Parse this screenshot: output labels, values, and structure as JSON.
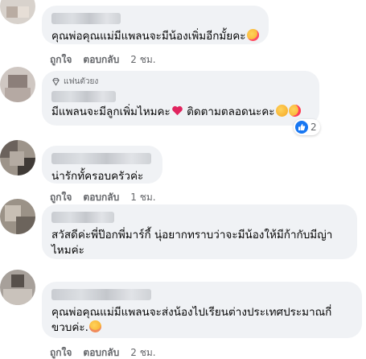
{
  "colors": {
    "bubble": "#f0f2f5",
    "meta": "#65676b",
    "text": "#050505",
    "like": "#1877f2"
  },
  "comments": [
    {
      "text": "คุณพ่อคุณแม่มีแพลนจะมีน้องเพิ่มอีกมั้ยคะ",
      "emoji": "smiling-face-with-hearts",
      "like": "ถูกใจ",
      "reply": "ตอบกลับ",
      "time": "2 ชม."
    },
    {
      "badge": "แฟนตัวยง",
      "text": "มีแพลนจะมีลูกเพิ่มไหมคะ",
      "text2": " ติดตามตลอดนะคะ",
      "reaction_count": "2"
    },
    {
      "text": "น่ารักทั้ครอบครัวค่ะ",
      "like": "ถูกใจ",
      "reply": "ตอบกลับ",
      "time": "1 ชม."
    },
    {
      "text": "สวัสดีค่ะพี่ป๊อกพี่มาร์กี้ นุ่อยากทราบว่าจะมีน้องให้มีก้ากับมีญ่า\nไหมค่ะ"
    },
    {
      "text": "คุณพ่อคุณแม่มีแพลนจะส่งน้องไปเรียนต่างประเทศประมาณกี่\nขวบค่ะ.",
      "like": "ถูกใจ",
      "reply": "ตอบกลับ",
      "time": "2 ชม."
    }
  ]
}
